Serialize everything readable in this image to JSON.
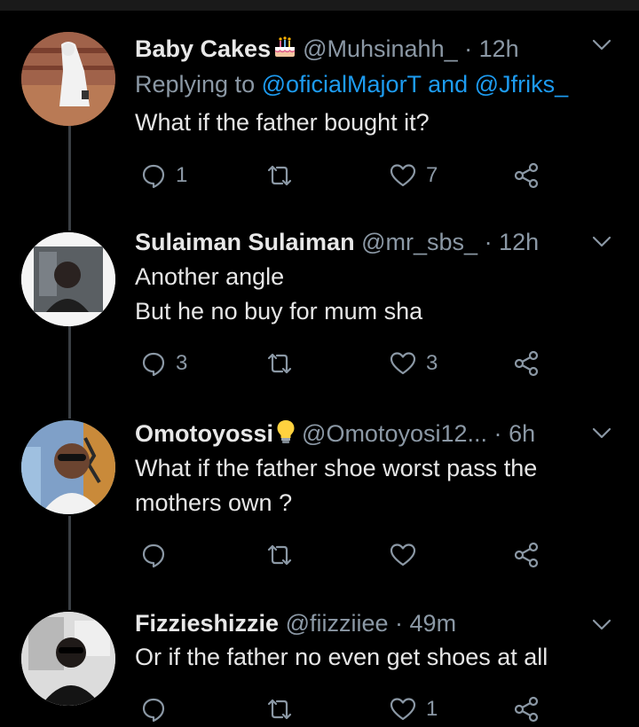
{
  "tweets": [
    {
      "name": "Baby Cakes",
      "name_emoji": "birthday-cake-emoji",
      "handle": "@Muhsinahh_",
      "dot": "·",
      "time": "12h",
      "reply_prefix": "Replying to",
      "reply_mention_1": "@oficialMajorT",
      "reply_and": "and",
      "reply_mention_2": "@Jfriks_",
      "lines": [
        "What if the father bought it?"
      ],
      "reply_count": "1",
      "like_count": "7"
    },
    {
      "name": "Sulaiman Sulaiman",
      "handle": "@mr_sbs_",
      "dot": "·",
      "time": "12h",
      "lines": [
        "Another angle",
        "But he no buy for mum sha"
      ],
      "reply_count": "3",
      "like_count": "3"
    },
    {
      "name": "Omotoyossi",
      "name_emoji": "lightbulb-emoji",
      "handle": "@Omotoyosi12...",
      "dot": "·",
      "time": "6h",
      "lines": [
        "What if the father shoe worst pass the",
        "mothers own ?"
      ],
      "reply_count": "",
      "like_count": ""
    },
    {
      "name": "Fizzieshizzie",
      "handle": "@fiizziiee",
      "dot": "·",
      "time": "49m",
      "lines": [
        "Or if the father no even get shoes at all"
      ],
      "reply_count": "",
      "like_count": "1"
    }
  ],
  "colors": {
    "background": "#000000",
    "secondary_text": "#8b98a5",
    "mention": "#1d9bf0",
    "thread_line": "#3a3f44"
  }
}
